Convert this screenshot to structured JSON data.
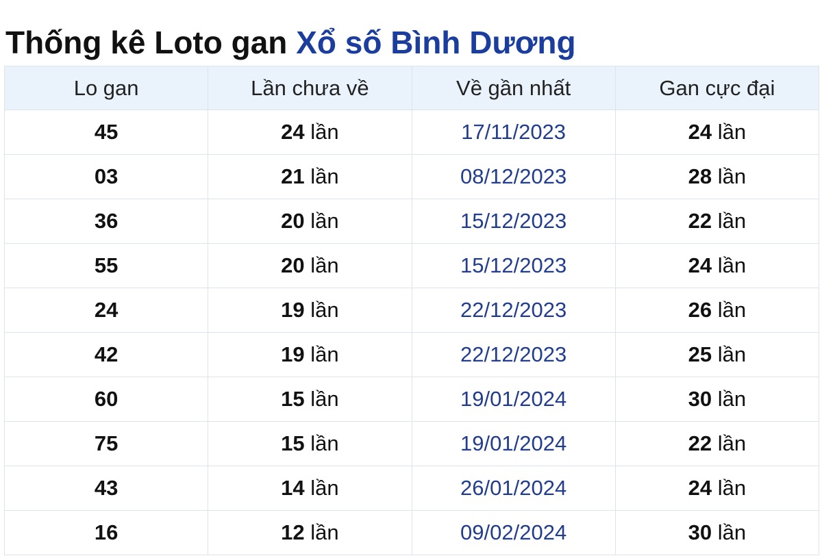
{
  "title": {
    "prefix": "Thống kê Loto gan ",
    "link": "Xổ số Bình Dương"
  },
  "colors": {
    "title_link": "#1a3d9e",
    "date_link": "#223c8e",
    "header_bg": "#eaf3fb",
    "border": "#dde3ec"
  },
  "table": {
    "headers": [
      "Lo gan",
      "Lần chưa về",
      "Về gần nhất",
      "Gan cực đại"
    ],
    "unit": "lần",
    "rows": [
      {
        "lo": "45",
        "chua_ve": "24",
        "gan_nhat": "17/11/2023",
        "cuc_dai": "24"
      },
      {
        "lo": "03",
        "chua_ve": "21",
        "gan_nhat": "08/12/2023",
        "cuc_dai": "28"
      },
      {
        "lo": "36",
        "chua_ve": "20",
        "gan_nhat": "15/12/2023",
        "cuc_dai": "22"
      },
      {
        "lo": "55",
        "chua_ve": "20",
        "gan_nhat": "15/12/2023",
        "cuc_dai": "24"
      },
      {
        "lo": "24",
        "chua_ve": "19",
        "gan_nhat": "22/12/2023",
        "cuc_dai": "26"
      },
      {
        "lo": "42",
        "chua_ve": "19",
        "gan_nhat": "22/12/2023",
        "cuc_dai": "25"
      },
      {
        "lo": "60",
        "chua_ve": "15",
        "gan_nhat": "19/01/2024",
        "cuc_dai": "30"
      },
      {
        "lo": "75",
        "chua_ve": "15",
        "gan_nhat": "19/01/2024",
        "cuc_dai": "22"
      },
      {
        "lo": "43",
        "chua_ve": "14",
        "gan_nhat": "26/01/2024",
        "cuc_dai": "24"
      },
      {
        "lo": "16",
        "chua_ve": "12",
        "gan_nhat": "09/02/2024",
        "cuc_dai": "30"
      }
    ]
  }
}
